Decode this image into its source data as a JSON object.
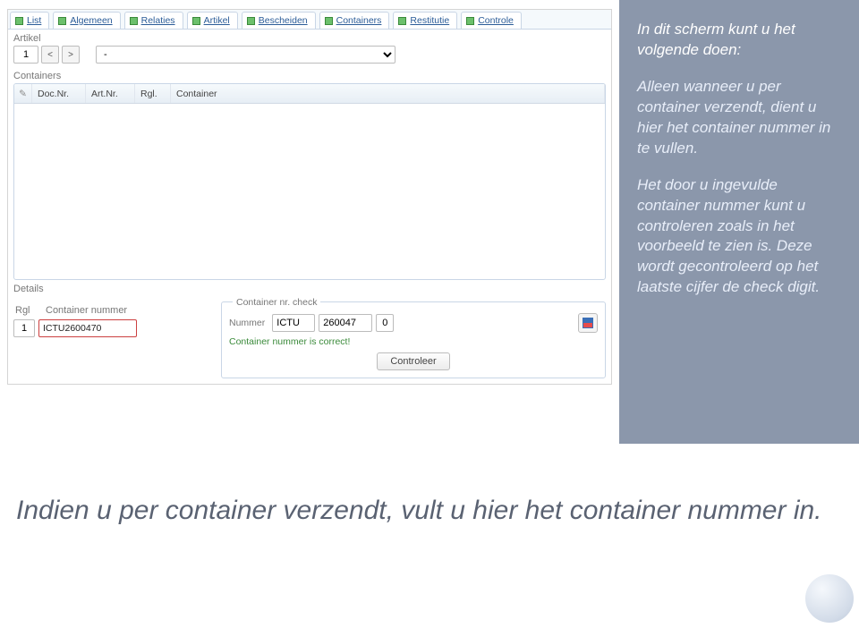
{
  "tabs": [
    {
      "label": "List"
    },
    {
      "label": "Algemeen"
    },
    {
      "label": "Relaties"
    },
    {
      "label": "Artikel"
    },
    {
      "label": "Bescheiden"
    },
    {
      "label": "Containers"
    },
    {
      "label": "Restitutie"
    },
    {
      "label": "Controle"
    }
  ],
  "artikel": {
    "label": "Artikel",
    "index": "1",
    "prev": "<",
    "next": ">",
    "filter": "-"
  },
  "containers": {
    "label": "Containers",
    "headers": {
      "edit": "✎",
      "doc": "Doc.Nr.",
      "art": "Art.Nr.",
      "rgl": "Rgl.",
      "container": "Container"
    }
  },
  "details": {
    "label": "Details",
    "rgl_label": "Rgl",
    "container_label": "Container nummer",
    "rgl_value": "1",
    "container_value": "ICTU2600470"
  },
  "check": {
    "legend": "Container nr. check",
    "nummer_label": "Nummer",
    "prefix": "ICTU",
    "serial": "260047",
    "checkdigit": "0",
    "message": "Container nummer is correct!",
    "button": "Controleer"
  },
  "info_panel": {
    "p1": "In dit scherm kunt u het volgende doen:",
    "p2": "Alleen wanneer u per container verzendt, dient u hier het container nummer in te vullen.",
    "p3": "Het door u ingevulde container nummer kunt u controleren zoals in het voorbeeld te zien is. Deze wordt gecontroleerd op het laatste cijfer de check digit."
  },
  "caption": "Indien u per container verzendt, vult u hier het container nummer in."
}
